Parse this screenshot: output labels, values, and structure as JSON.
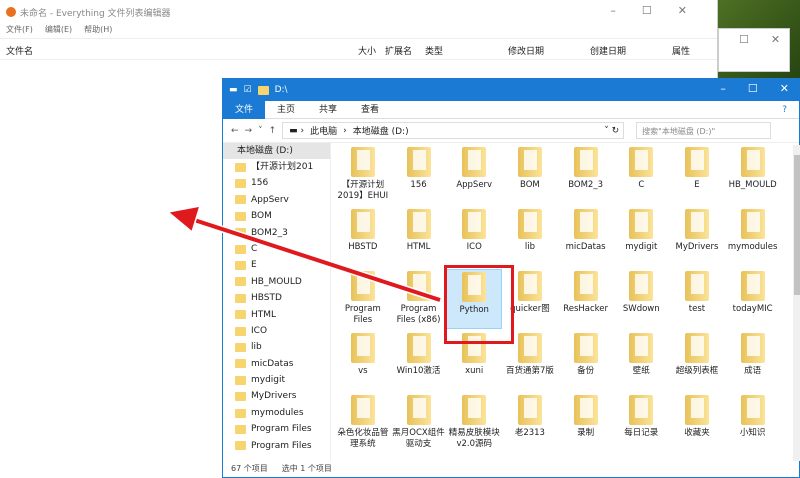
{
  "everything": {
    "title": "未命名 - Everything 文件列表编辑器",
    "menu": [
      "文件(F)",
      "编辑(E)",
      "帮助(H)"
    ],
    "columns": [
      "文件名",
      "大小",
      "扩展名",
      "类型",
      "修改日期",
      "创建日期",
      "属性"
    ]
  },
  "explorer": {
    "title": "D:\\",
    "ribbon": [
      "文件",
      "主页",
      "共享",
      "查看"
    ],
    "path": [
      "此电脑",
      "本地磁盘 (D:)"
    ],
    "search_placeholder": "搜索\"本地磁盘 (D:)\"",
    "nav_header": "本地磁盘 (D:)",
    "nav": [
      "【开源计划201",
      "156",
      "AppServ",
      "BOM",
      "BOM2_3",
      "C",
      "E",
      "HB_MOULD",
      "HBSTD",
      "HTML",
      "ICO",
      "lib",
      "micDatas",
      "mydigit",
      "MyDrivers",
      "mymodules",
      "Program Files",
      "Program Files"
    ],
    "items": [
      "【开源计划2019】EHUI",
      "156",
      "AppServ",
      "BOM",
      "BOM2_3",
      "C",
      "E",
      "HB_MOULD",
      "HBSTD",
      "HTML",
      "ICO",
      "lib",
      "micDatas",
      "mydigit",
      "MyDrivers",
      "mymodules",
      "Program Files",
      "Program Files (x86)",
      "Python",
      "quicker图",
      "ResHacker",
      "SWdown",
      "test",
      "todayMIC",
      "vs",
      "Win10激活",
      "xuni",
      "百货通第7版",
      "备份",
      "壁纸",
      "超级列表框",
      "成语",
      "朵色化妆品管理系统",
      "黑月OCX组件驱动支",
      "精易皮肤模块v2.0源码",
      "老2313",
      "录制",
      "每日记录",
      "收藏夹",
      "小知识"
    ],
    "selected": "Python",
    "status_count": "67 个项目",
    "status_sel": "选中 1 个项目"
  },
  "colors": {
    "accent": "#1a7ad4",
    "highlight": "#e0191e"
  }
}
